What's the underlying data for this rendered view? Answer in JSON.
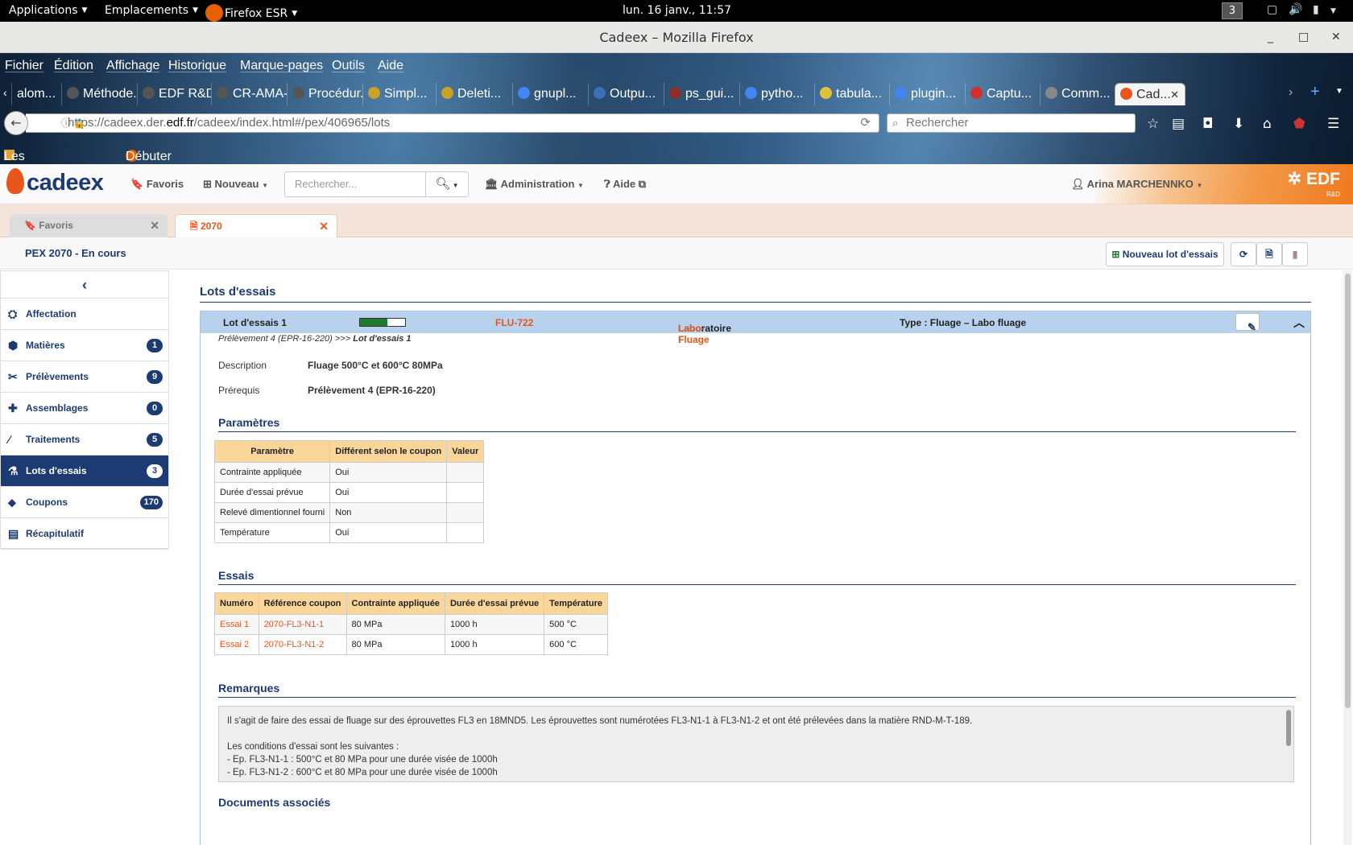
{
  "gnome": {
    "applications": "Applications",
    "places": "Emplacements",
    "app_menu": "Firefox ESR",
    "clock": "lun. 16 janv., 11:57",
    "workspace": "3"
  },
  "window": {
    "title": "Cadeex – Mozilla Firefox"
  },
  "firefox": {
    "menu": [
      "Fichier",
      "Édition",
      "Affichage",
      "Historique",
      "Marque-pages",
      "Outils",
      "Aide"
    ],
    "tabs": [
      {
        "label": "alom...",
        "color": "#555555"
      },
      {
        "label": "Méthode...",
        "color": "#555555"
      },
      {
        "label": "EDF R&D...",
        "color": "#555555"
      },
      {
        "label": "CR-AMA-...",
        "color": "#555555"
      },
      {
        "label": "Procédur...",
        "color": "#555555"
      },
      {
        "label": "Simpl...",
        "color": "#c9a227"
      },
      {
        "label": "Deleti...",
        "color": "#c9a227"
      },
      {
        "label": "gnupl...",
        "color": "#4285f4"
      },
      {
        "label": "Outpu...",
        "color": "#3b6fb6"
      },
      {
        "label": "ps_gui...",
        "color": "#8e2b2b"
      },
      {
        "label": "pytho...",
        "color": "#4285f4"
      },
      {
        "label": "tabula...",
        "color": "#e0c13b"
      },
      {
        "label": "plugin...",
        "color": "#4285f4"
      },
      {
        "label": "Captu...",
        "color": "#d32f2f"
      },
      {
        "label": "Comm...",
        "color": "#888888"
      },
      {
        "label": "Cad...",
        "color": "#e8561c"
      }
    ],
    "url_prefix": "https://cadeex.der.",
    "url_domain": "edf.fr",
    "url_suffix": "/cadeex/index.html#/pex/406965/lots",
    "search_placeholder": "Rechercher",
    "bookmarks": [
      "Les plus visités",
      "Débuter avec Firefox"
    ]
  },
  "app": {
    "logo": "cadeex",
    "nav": {
      "favoris": "Favoris",
      "nouveau": "Nouveau",
      "search_placeholder": "Rechercher...",
      "administration": "Administration",
      "aide": "Aide",
      "user": "Arina MARCHENNKO"
    },
    "brand": {
      "name": "EDF",
      "sub": "R&D"
    },
    "doctabs": [
      {
        "label": "Favoris"
      },
      {
        "label": "2070"
      }
    ],
    "page_title": "PEX 2070 - En cours",
    "new_lot_button": "Nouveau lot d'essais"
  },
  "sidebar": {
    "items": [
      {
        "label": "Affectation",
        "badge": "",
        "icon": "user-plus-icon"
      },
      {
        "label": "Matières",
        "badge": "1",
        "icon": "cube-icon"
      },
      {
        "label": "Prélèvements",
        "badge": "9",
        "icon": "scissors-icon"
      },
      {
        "label": "Assemblages",
        "badge": "0",
        "icon": "puzzle-icon"
      },
      {
        "label": "Traitements",
        "badge": "5",
        "icon": "wand-icon"
      },
      {
        "label": "Lots d'essais",
        "badge": "3",
        "icon": "flask-icon"
      },
      {
        "label": "Coupons",
        "badge": "170",
        "icon": "tag-icon"
      },
      {
        "label": "Récapitulatif",
        "badge": "",
        "icon": "book-icon"
      }
    ]
  },
  "main": {
    "section_title": "Lots d'essais",
    "lot": {
      "name": "Lot d'essais 1",
      "progress": 0.6,
      "code": "FLU-722",
      "lab_label": "Laboratoire :",
      "lab_value": "Labo-Fluage",
      "type": "Type : Fluage – Labo fluage",
      "breadcrumb_prefix": "Prélèvement 4 (EPR-16-220) >>> ",
      "breadcrumb_current": "Lot d'essais 1",
      "description_label": "Description",
      "description_value": "Fluage 500°C et 600°C 80MPa",
      "prereq_label": "Prérequis",
      "prereq_value": "Prélèvement 4 (EPR-16-220)"
    },
    "params": {
      "title": "Paramètres",
      "headers": [
        "Paramètre",
        "Différent selon le coupon",
        "Valeur"
      ],
      "rows": [
        [
          "Contrainte appliquée",
          "Oui",
          ""
        ],
        [
          "Durée d'essai prévue",
          "Oui",
          ""
        ],
        [
          "Relevé dimentionnel fourni",
          "Non",
          ""
        ],
        [
          "Température",
          "Oui",
          ""
        ]
      ]
    },
    "essais": {
      "title": "Essais",
      "headers": [
        "Numéro",
        "Référence coupon",
        "Contrainte appliquée",
        "Durée d'essai prévue",
        "Température"
      ],
      "rows": [
        [
          "Essai 1",
          "2070-FL3-N1-1",
          "80 MPa",
          "1000 h",
          "500 °C"
        ],
        [
          "Essai 2",
          "2070-FL3-N1-2",
          "80 MPa",
          "1000 h",
          "600 °C"
        ]
      ]
    },
    "remarks": {
      "title": "Remarques",
      "lines": [
        "Il s'agit de faire des essai de fluage sur des éprouvettes FL3 en 18MND5. Les éprouvettes sont numérotées FL3-N1-1 à FL3-N1-2 et ont été prélevées dans la matière RND-M-T-189.",
        "",
        "Les conditions d'essai sont les suivantes :",
        "- Ep. FL3-N1-1 : 500°C et 80 MPa pour une durée visée de 1000h",
        "- Ep. FL3-N1-2 : 600°C et 80 MPa pour une durée visée de 1000h"
      ]
    },
    "documents_title": "Documents associés"
  }
}
